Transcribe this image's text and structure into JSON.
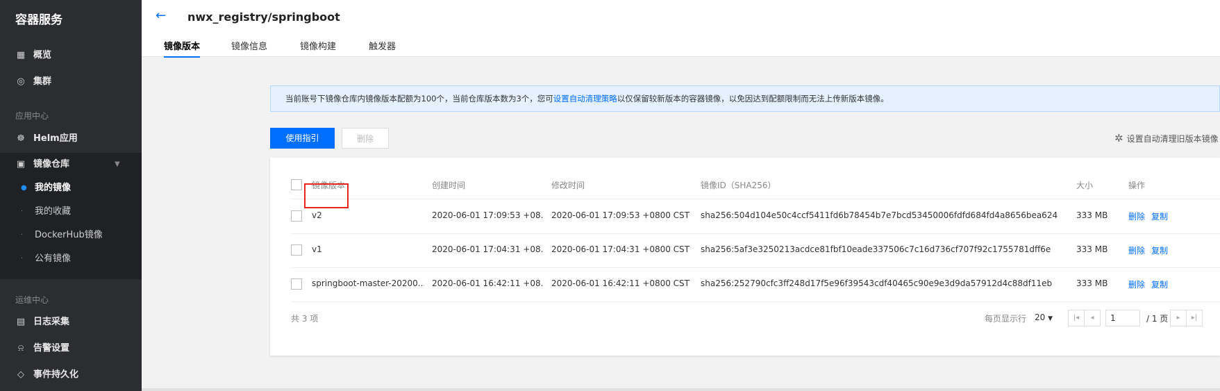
{
  "sidebar": {
    "title": "容器服务",
    "overview": {
      "icon": "grid-icon",
      "label": "概览"
    },
    "cluster": {
      "icon": "cluster-icon",
      "label": "集群"
    },
    "group_app": "应用中心",
    "helm": {
      "icon": "helm-icon",
      "label": "Helm应用"
    },
    "registry": {
      "icon": "registry-icon",
      "label": "镜像仓库"
    },
    "registry_sub": [
      "我的镜像",
      "我的收藏",
      "DockerHub镜像",
      "公有镜像"
    ],
    "group_ops": "运维中心",
    "log": {
      "icon": "calendar-icon",
      "label": "日志采集"
    },
    "alarm": {
      "icon": "alarm-icon",
      "label": "告警设置"
    },
    "event": {
      "icon": "layers-icon",
      "label": "事件持久化"
    }
  },
  "header": {
    "title": "nwx_registry/springboot",
    "tabs": [
      "镜像版本",
      "镜像信息",
      "镜像构建",
      "触发器"
    ],
    "active_tab": "镜像版本"
  },
  "notice": {
    "text_before": "当前账号下镜像仓库内镜像版本配额为100个，当前仓库版本数为3个，您可",
    "link": "设置自动清理策略",
    "text_after": "以仅保留较新版本的容器镜像，以免因达到配额限制而无法上传新版本镜像。"
  },
  "toolbar": {
    "guide_label": "使用指引",
    "delete_label": "删除",
    "auto_clean_label": "设置自动清理旧版本镜像"
  },
  "table": {
    "columns": [
      "镜像版本",
      "创建时间",
      "修改时间",
      "镜像ID（SHA256）",
      "大小",
      "操作"
    ],
    "rows": [
      {
        "version": "v2",
        "created": "2020-06-01 17:09:53 +08...",
        "modified": "2020-06-01 17:09:53 +0800 CST",
        "id": "sha256:504d104e50c4ccf5411fd6b78454b7e7bcd53450006fdfd684fd4a8656bea624",
        "size": "333 MB",
        "action_delete": "删除",
        "action_copy": "复制"
      },
      {
        "version": "v1",
        "created": "2020-06-01 17:04:31 +08...",
        "modified": "2020-06-01 17:04:31 +0800 CST",
        "id": "sha256:5af3e3250213acdce81fbf10eade337506c7c16d736cf707f92c1755781dff6e",
        "size": "333 MB",
        "action_delete": "删除",
        "action_copy": "复制"
      },
      {
        "version": "springboot-master-20200...",
        "created": "2020-06-01 16:42:11 +08...",
        "modified": "2020-06-01 16:42:11 +0800 CST",
        "id": "sha256:252790cfc3ff248d17f5e96f39543cdf40465c90e9e3d9da57912d4c88df11eb",
        "size": "333 MB",
        "action_delete": "删除",
        "action_copy": "复制"
      }
    ],
    "total": "共 3 项",
    "page_size_label": "每页显示行",
    "page_size": "20",
    "page_current": "1",
    "page_total": "/ 1 页"
  },
  "colors": {
    "accent": "#006eff",
    "sidebar_bg": "#2b2d31",
    "highlight": "#e8221c"
  }
}
